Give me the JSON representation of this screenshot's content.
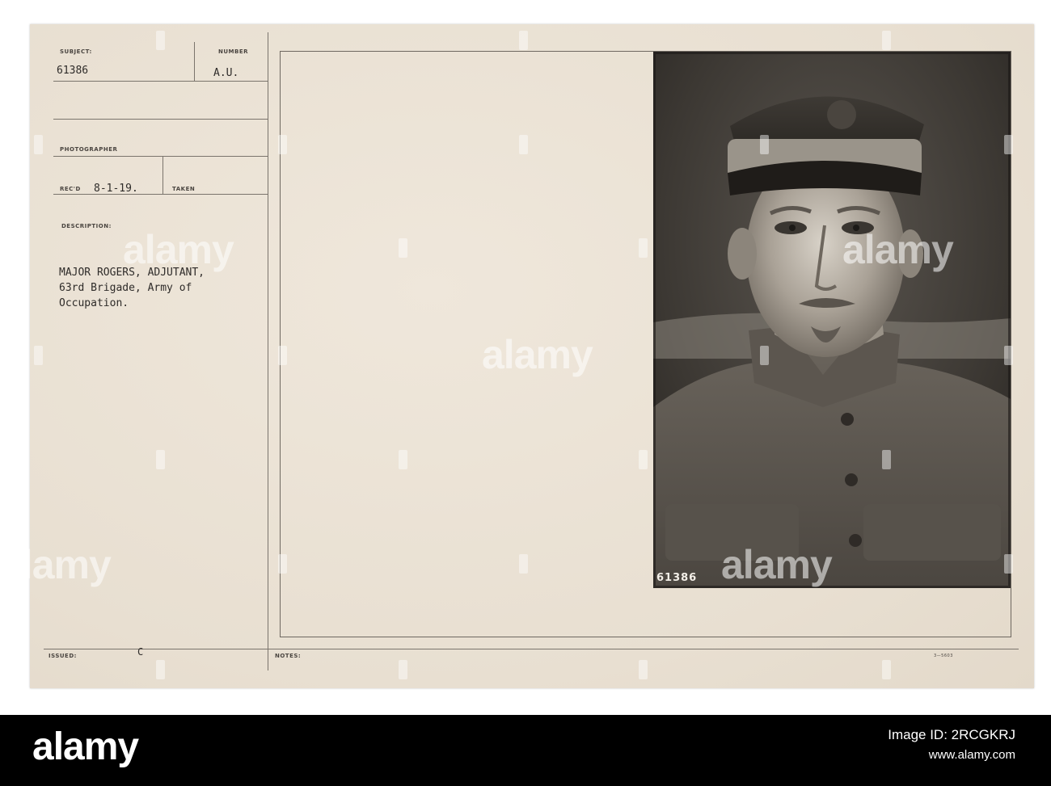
{
  "card": {
    "subject_label": "SUBJECT:",
    "subject_value": "61386",
    "number_label": "NUMBER",
    "number_value": "A.U.",
    "photographer_label": "PHOTOGRAPHER",
    "recd_label": "REC'D",
    "recd_value": "8-1-19.",
    "taken_label": "TAKEN",
    "description_label": "DESCRIPTION:",
    "description_lines": [
      "MAJOR ROGERS, ADJUTANT,",
      "63rd Brigade, Army of",
      "Occupation."
    ],
    "issued_label": "ISSUED:",
    "issued_value": "C",
    "notes_label": "NOTES:",
    "form_code": "3—5603"
  },
  "photo": {
    "number": "61386",
    "subject_icon": "portrait-officer"
  },
  "watermark": {
    "text": "alamy"
  },
  "footer": {
    "logo": "alamy",
    "image_id": "Image ID: 2RCGKRJ",
    "url": "www.alamy.com"
  },
  "colors": {
    "card": "#ebe2d5",
    "ink": "#2e2b29",
    "footer": "#000000"
  }
}
